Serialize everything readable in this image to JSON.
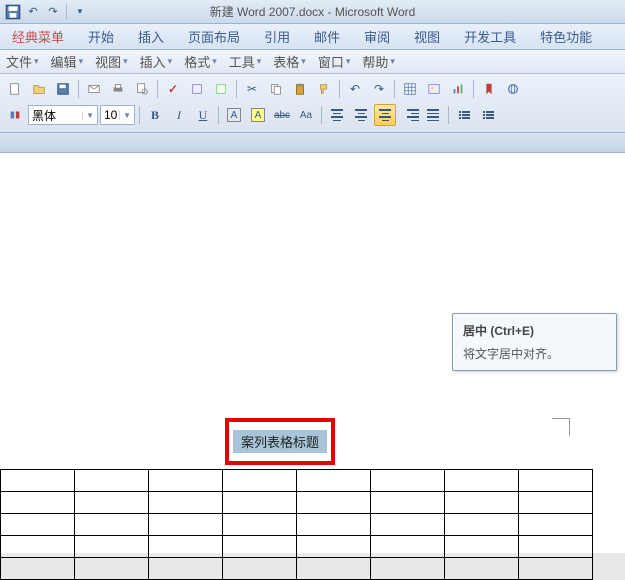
{
  "title": "新建 Word 2007.docx - Microsoft Word",
  "menubar": [
    "经典菜单",
    "开始",
    "插入",
    "页面布局",
    "引用",
    "邮件",
    "审阅",
    "视图",
    "开发工具",
    "特色功能"
  ],
  "dropbar": [
    "文件",
    "编辑",
    "视图",
    "插入",
    "格式",
    "工具",
    "表格",
    "窗口",
    "帮助"
  ],
  "font": {
    "name": "黑体",
    "size": "10"
  },
  "fmt": {
    "bold": "B",
    "italic": "I",
    "underline": "U",
    "A1": "A",
    "A2": "A",
    "abc": "abc",
    "Aa": "Aa"
  },
  "tooltip": {
    "title": "居中 (Ctrl+E)",
    "body": "将文字居中对齐。"
  },
  "tableTitle": "案列表格标题",
  "table": {
    "rows": 5,
    "cols": 8
  }
}
